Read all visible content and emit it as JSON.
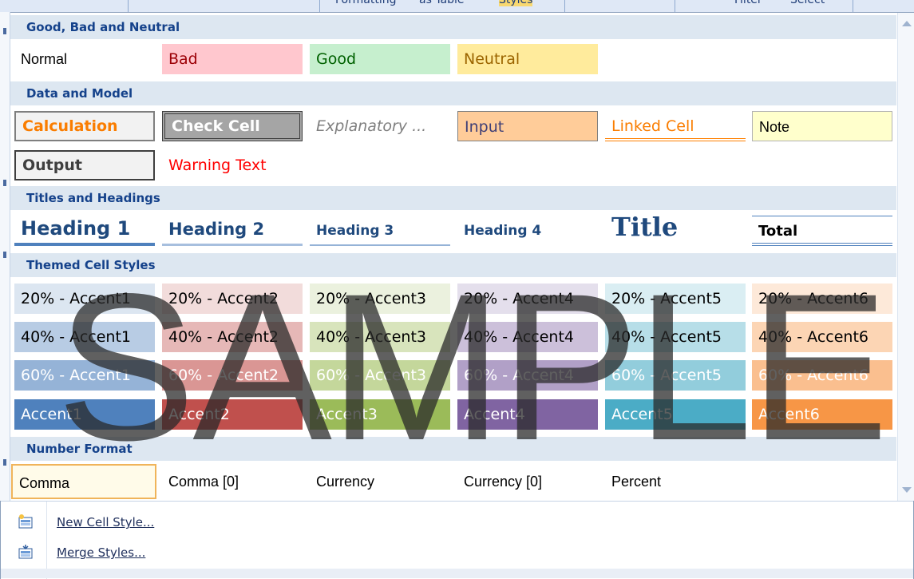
{
  "ribbon": {
    "partial_labels": [
      "Formatting",
      "as Table",
      "Styles",
      "Filter",
      "Select"
    ]
  },
  "sections": {
    "good_bad_neutral": "Good, Bad and Neutral",
    "data_model": "Data and Model",
    "titles_headings": "Titles and Headings",
    "themed": "Themed Cell Styles",
    "number_format": "Number Format"
  },
  "good_bad_neutral": {
    "normal": "Normal",
    "bad": "Bad",
    "good": "Good",
    "neutral": "Neutral"
  },
  "data_model": {
    "calculation": "Calculation",
    "check_cell": "Check Cell",
    "explanatory": "Explanatory ...",
    "input": "Input",
    "linked_cell": "Linked Cell",
    "note": "Note",
    "output": "Output",
    "warning_text": "Warning Text"
  },
  "titles_headings": {
    "heading1": "Heading 1",
    "heading2": "Heading 2",
    "heading3": "Heading 3",
    "heading4": "Heading 4",
    "title": "Title",
    "total": "Total"
  },
  "themed": {
    "row20": [
      "20% - Accent1",
      "20% - Accent2",
      "20% - Accent3",
      "20% - Accent4",
      "20% - Accent5",
      "20% - Accent6"
    ],
    "row40": [
      "40% - Accent1",
      "40% - Accent2",
      "40% - Accent3",
      "40% - Accent4",
      "40% - Accent5",
      "40% - Accent6"
    ],
    "row60": [
      "60% - Accent1",
      "60% - Accent2",
      "60% - Accent3",
      "60% - Accent4",
      "60% - Accent5",
      "60% - Accent6"
    ],
    "row100": [
      "Accent1",
      "Accent2",
      "Accent3",
      "Accent4",
      "Accent5",
      "Accent6"
    ]
  },
  "number_format": {
    "comma": "Comma",
    "comma0": "Comma [0]",
    "currency": "Currency",
    "currency0": "Currency [0]",
    "percent": "Percent"
  },
  "menu": {
    "new_style": "New Cell Style...",
    "merge_styles": "Merge Styles..."
  },
  "watermark": "SAMPLE",
  "colors": {
    "header_bg": "#dde7f1",
    "header_text": "#15428b",
    "bad_bg": "#ffc7ce",
    "bad_text": "#9c0006",
    "good_bg": "#c6efce",
    "good_text": "#006100",
    "neutral_bg": "#ffeb9c",
    "neutral_text": "#9c6500",
    "accent1": "#4f81bd",
    "accent2": "#c0504d",
    "accent3": "#9bbb59",
    "accent4": "#8064a2",
    "accent5": "#4bacc6",
    "accent6": "#f79646"
  }
}
